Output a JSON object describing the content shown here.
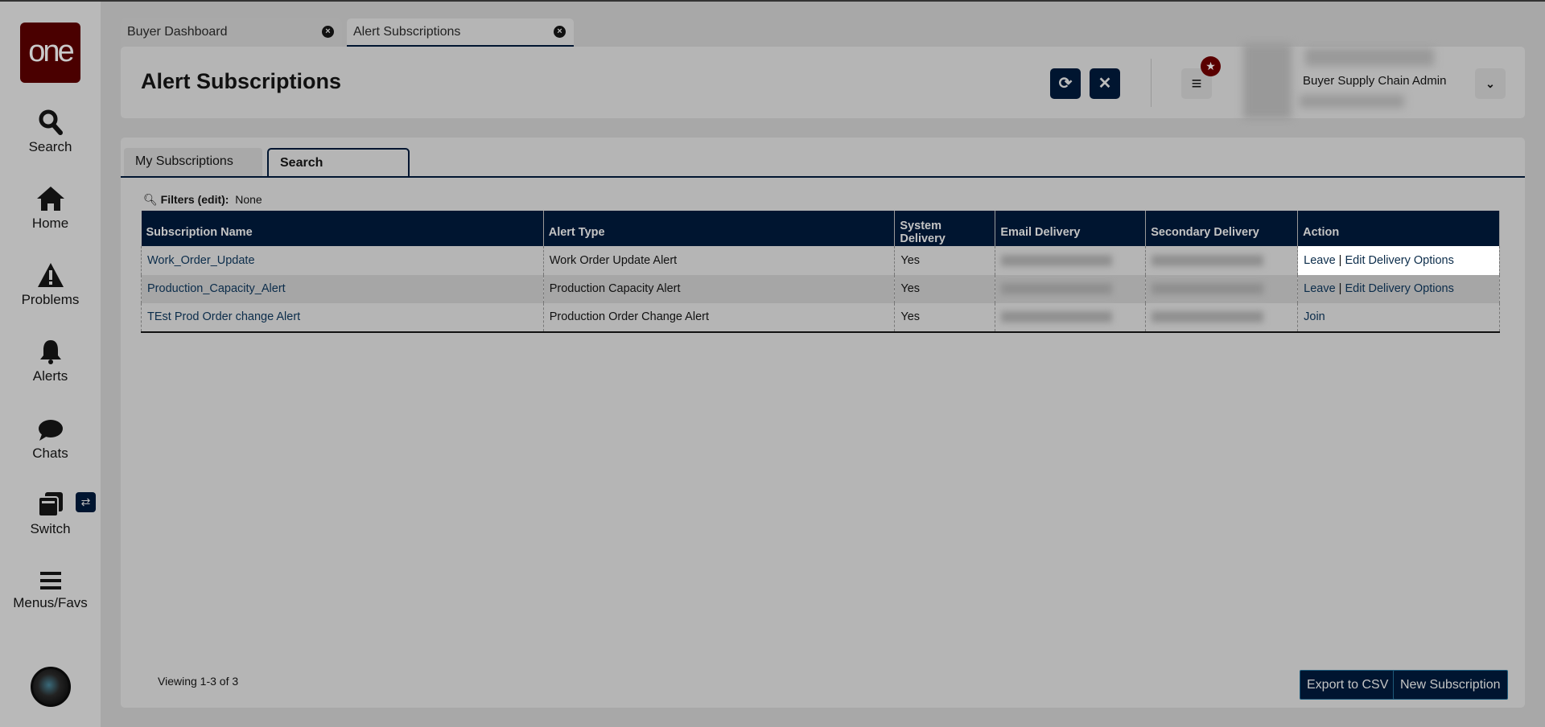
{
  "sidebar": {
    "logo": "one",
    "items": [
      {
        "label": "Search",
        "icon": "search-icon"
      },
      {
        "label": "Home",
        "icon": "home-icon"
      },
      {
        "label": "Problems",
        "icon": "warning-icon"
      },
      {
        "label": "Alerts",
        "icon": "bell-icon"
      },
      {
        "label": "Chats",
        "icon": "chat-icon"
      },
      {
        "label": "Switch",
        "icon": "switch-icon"
      },
      {
        "label": "Menus/Favs",
        "icon": "menu-icon"
      }
    ]
  },
  "tabs": [
    {
      "label": "Buyer Dashboard",
      "active": false
    },
    {
      "label": "Alert Subscriptions",
      "active": true
    }
  ],
  "header": {
    "title": "Alert Subscriptions",
    "user_role": "Buyer Supply Chain Admin"
  },
  "subtabs": [
    {
      "label": "My Subscriptions"
    },
    {
      "label": "Search"
    }
  ],
  "filters": {
    "label": "Filters (edit):",
    "value": "None"
  },
  "table": {
    "columns": [
      "Subscription Name",
      "Alert Type",
      "System Delivery",
      "Email Delivery",
      "Secondary Delivery",
      "Action"
    ],
    "rows": [
      {
        "name": "Work_Order_Update",
        "type": "Work Order Update Alert",
        "system": "Yes",
        "actions": [
          "Leave",
          "Edit Delivery Options"
        ]
      },
      {
        "name": "Production_Capacity_Alert",
        "type": "Production Capacity Alert",
        "system": "Yes",
        "actions": [
          "Leave",
          "Edit Delivery Options"
        ]
      },
      {
        "name": "TEst Prod Order change Alert",
        "type": "Production Order Change Alert",
        "system": "Yes",
        "actions": [
          "Join"
        ]
      }
    ],
    "separator": "|"
  },
  "footer": {
    "viewing": "Viewing 1-3 of 3",
    "export_label": "Export to CSV",
    "new_label": "New Subscription"
  },
  "colors": {
    "navy": "#001530",
    "logo": "#4a0000",
    "link": "#0b2c4a"
  }
}
